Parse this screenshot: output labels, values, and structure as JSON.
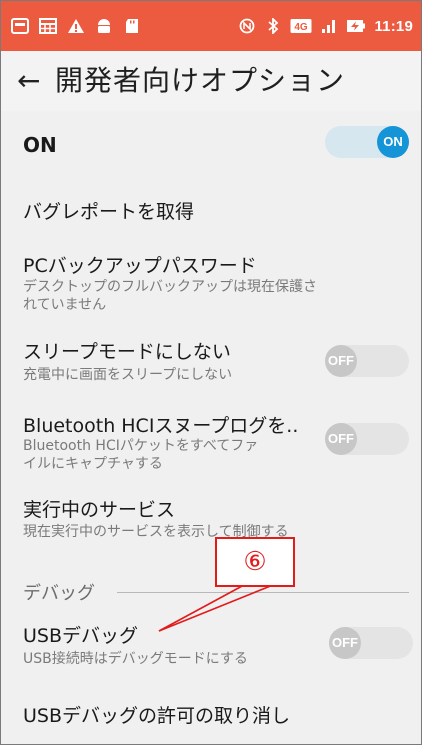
{
  "status_bar": {
    "time": "11:19",
    "network_badge": "4G",
    "left_icons": [
      "notification-icon",
      "calendar-icon",
      "warning-icon",
      "android-icon",
      "sd-card-icon"
    ],
    "right_icons": [
      "nfc-icon",
      "bluetooth-icon",
      "lte-icon",
      "signal-icon",
      "battery-charging-icon"
    ],
    "bg_color": "#ec5a3f"
  },
  "header": {
    "back_symbol": "←",
    "title": "開発者向けオプション"
  },
  "master_toggle": {
    "label": "ON",
    "state": "ON"
  },
  "settings": [
    {
      "title": "バグレポートを取得"
    },
    {
      "title": "PCバックアップパスワード",
      "summary_lines": [
        "デスクトップのフルバックアップは現在保護さ",
        "れていません"
      ]
    },
    {
      "title": "スリープモードにしない",
      "summary_lines": [
        "充電中に画面をスリープにしない"
      ],
      "toggle": "OFF"
    },
    {
      "title": "Bluetooth HCIスヌープログを..",
      "summary_lines": [
        "Bluetooth HCIパケットをすべてファ",
        "イルにキャプチャする"
      ],
      "toggle": "OFF"
    },
    {
      "title": "実行中のサービス",
      "summary_lines": [
        "現在実行中のサービスを表示して制御する"
      ]
    },
    {
      "title": "USBデバッグ",
      "summary_lines": [
        "USB接続時はデバッグモードにする"
      ],
      "toggle": "OFF"
    },
    {
      "title": "USBデバッグの許可の取り消し"
    }
  ],
  "section": {
    "debug_header": "デバッグ"
  },
  "annotation": {
    "label": "⑥",
    "color": "#e21b1b"
  },
  "colors": {
    "switch_on_knob": "#1594d8",
    "switch_on_track": "#d6e7ef",
    "switch_off_knob": "#c7c7c7",
    "switch_off_track": "#e4e4e4"
  }
}
